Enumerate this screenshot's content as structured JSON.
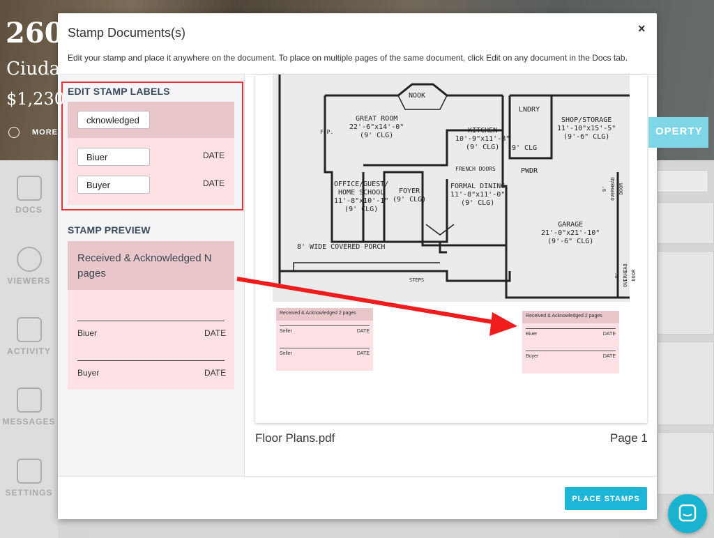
{
  "background": {
    "hero_number": "260",
    "hero_city": "Ciuda",
    "hero_price": "$1,230",
    "more_label": "MORE",
    "hero_button": "OPERTY",
    "nav": [
      {
        "label": "DOCS",
        "icon": "docs-icon"
      },
      {
        "label": "VIEWERS",
        "icon": "viewers-icon"
      },
      {
        "label": "ACTIVITY",
        "icon": "activity-icon"
      },
      {
        "label": "MESSAGES",
        "icon": "messages-icon"
      },
      {
        "label": "SETTINGS",
        "icon": "settings-icon"
      }
    ]
  },
  "modal": {
    "title": "Stamp Documents(s)",
    "close": "×",
    "subtitle": "Edit your stamp and place it anywhere on the document. To place on multiple pages of the same document, click Edit on any document in the Docs tab.",
    "edit": {
      "heading": "EDIT STAMP LABELS",
      "title_value": "cknowledged",
      "rows": [
        {
          "value": "Biuer",
          "date": "DATE"
        },
        {
          "value": "Buyer",
          "date": "DATE"
        }
      ]
    },
    "preview": {
      "heading": "STAMP PREVIEW",
      "title": "Received & Acknowledged N pages",
      "rows": [
        {
          "label": "Biuer",
          "date": "DATE"
        },
        {
          "label": "Buyer",
          "date": "DATE"
        }
      ]
    },
    "document": {
      "name": "Floor Plans.pdf",
      "page": "Page 1",
      "rooms": [
        "NOOK",
        "GREAT ROOM\n22'-6\"x14'-0\"\n(9' CLG)",
        "LNDRY",
        "SHOP/STORAGE\n11'-10\"x15'-5\"\n(9'-6\" CLG)",
        "KITCHEN\n10'-9\"x11'-8\"\n(9' CLG)",
        "9' CLG",
        "FRENCH DOORS",
        "PWDR",
        "OFFICE/GUEST/\nHOME SCHOOL\n11'-8\"x10'-1\"\n(9' CLG)",
        "FOYER\n(9' CLG)",
        "FORMAL DINING\n11'-8\"x11'-0\"\n(9' CLG)",
        "GARAGE\n21'-0\"x21'-10\"\n(9'-6\" CLG)",
        "8' WIDE COVERED PORCH",
        "STEPS",
        "F.P.",
        "9' OVERHEAD DOOR",
        "9' OVERHEAD DOOR"
      ],
      "stamps": [
        {
          "title": "Received & Acknowledged 2 pages",
          "rows": [
            {
              "label": "Seller",
              "date": "DATE"
            },
            {
              "label": "Seller",
              "date": "DATE"
            }
          ]
        },
        {
          "title": "Received & Acknowledged 2 pages",
          "rows": [
            {
              "label": "Biuer",
              "date": "DATE"
            },
            {
              "label": "Buyer",
              "date": "DATE"
            }
          ]
        }
      ]
    },
    "place_button": "PLACE STAMPS"
  },
  "colors": {
    "accent": "#1fb5d6",
    "highlight_red": "#e8312e",
    "stamp_header": "#e8c6c9",
    "stamp_body": "#fde1e4"
  }
}
